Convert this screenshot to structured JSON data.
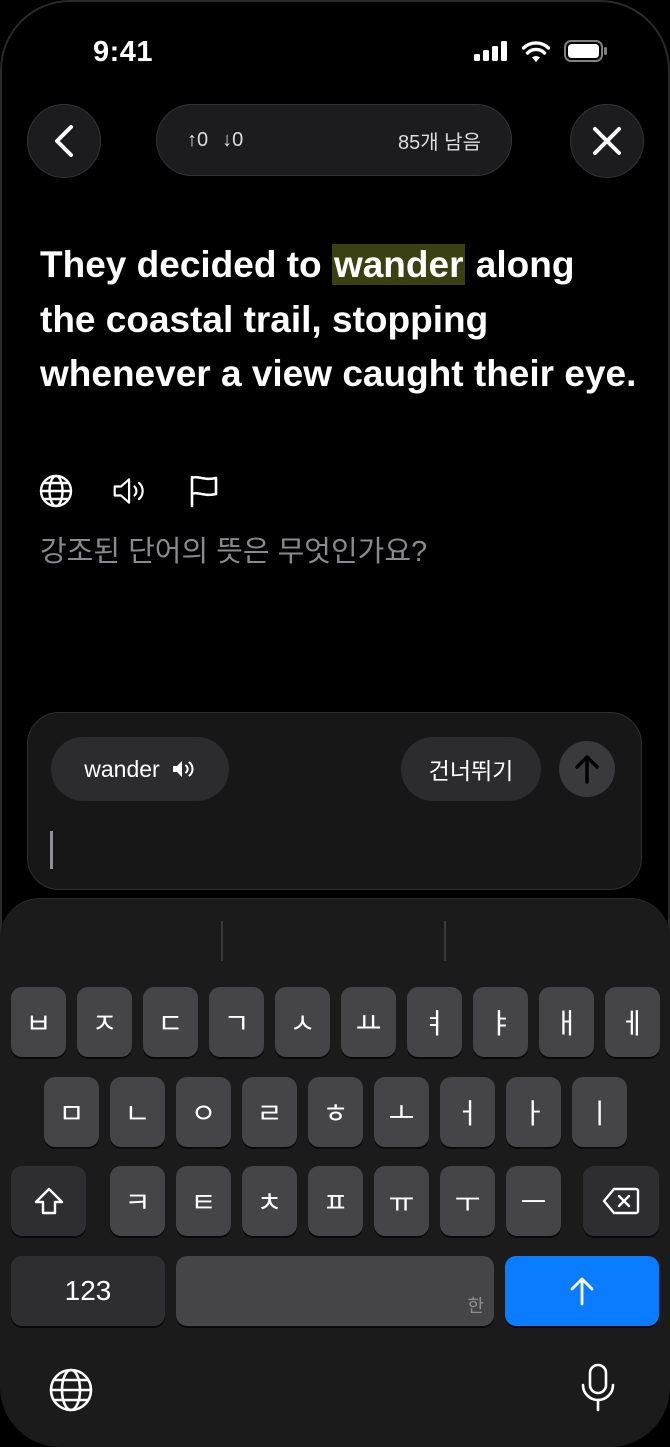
{
  "status": {
    "time": "9:41"
  },
  "header": {
    "up_count": "↑0",
    "down_count": "↓0",
    "remaining": "85개 남음"
  },
  "sentence": {
    "before": "They decided to ",
    "highlight": "wander",
    "after": " along the coastal trail, stopping whenever a view caught their eye."
  },
  "question": "강조된 단어의 뜻은 무엇인가요?",
  "answer": {
    "word_chip_label": "wander",
    "skip_label": "건너뛰기",
    "input_value": ""
  },
  "keyboard": {
    "row1": [
      "ㅂ",
      "ㅈ",
      "ㄷ",
      "ㄱ",
      "ㅅ",
      "ㅛ",
      "ㅕ",
      "ㅑ",
      "ㅐ",
      "ㅔ"
    ],
    "row2": [
      "ㅁ",
      "ㄴ",
      "ㅇ",
      "ㄹ",
      "ㅎ",
      "ㅗ",
      "ㅓ",
      "ㅏ",
      "ㅣ"
    ],
    "row3": [
      "ㅋ",
      "ㅌ",
      "ㅊ",
      "ㅍ",
      "ㅠ",
      "ㅜ",
      "ㅡ"
    ],
    "numbers_label": "123",
    "space_hint": "한",
    "accent": "#0a7cff"
  }
}
